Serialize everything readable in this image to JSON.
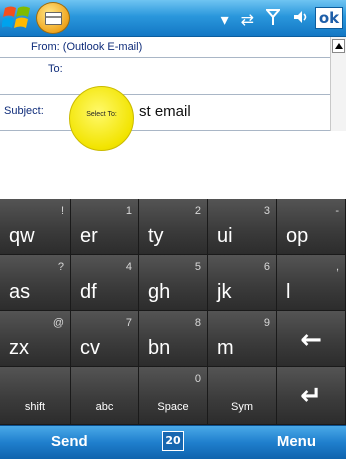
{
  "titlebar": {
    "ok_label": "ok",
    "status_icons": [
      "dropdown-arrow",
      "sync-arrows",
      "signal",
      "speaker"
    ]
  },
  "form": {
    "from_label": "From: (Outlook E-mail)",
    "to_label": "To:",
    "subject_label": "Subject:",
    "subject_value": "st email",
    "tooltip_text": "Select To:"
  },
  "keyboard": {
    "rows": [
      [
        {
          "main": "qw",
          "sub": "!"
        },
        {
          "main": "er",
          "sub": "1"
        },
        {
          "main": "ty",
          "sub": "2"
        },
        {
          "main": "ui",
          "sub": "3"
        },
        {
          "main": "op",
          "sub": "-"
        }
      ],
      [
        {
          "main": "as",
          "sub": "?"
        },
        {
          "main": "df",
          "sub": "4"
        },
        {
          "main": "gh",
          "sub": "5"
        },
        {
          "main": "jk",
          "sub": "6"
        },
        {
          "main": "l",
          "sub": ","
        }
      ],
      [
        {
          "main": "zx",
          "sub": "@"
        },
        {
          "main": "cv",
          "sub": "7"
        },
        {
          "main": "bn",
          "sub": "8"
        },
        {
          "main": "m",
          "sub": "9"
        },
        {
          "main": "",
          "icon": "backspace-arrow"
        }
      ],
      [
        {
          "small": "shift"
        },
        {
          "small": "abc"
        },
        {
          "small": "Space",
          "sub": "0"
        },
        {
          "small": "Sym"
        },
        {
          "main": "",
          "icon": "enter-arrow"
        }
      ]
    ]
  },
  "softkeys": {
    "left": "Send",
    "middle": "20",
    "right": "Menu"
  },
  "colors": {
    "titlebar_blue": "#2a97dc",
    "key_gray": "#3c3c3c",
    "tooltip_yellow": "#f2e400",
    "label_blue": "#0f2c7a"
  }
}
